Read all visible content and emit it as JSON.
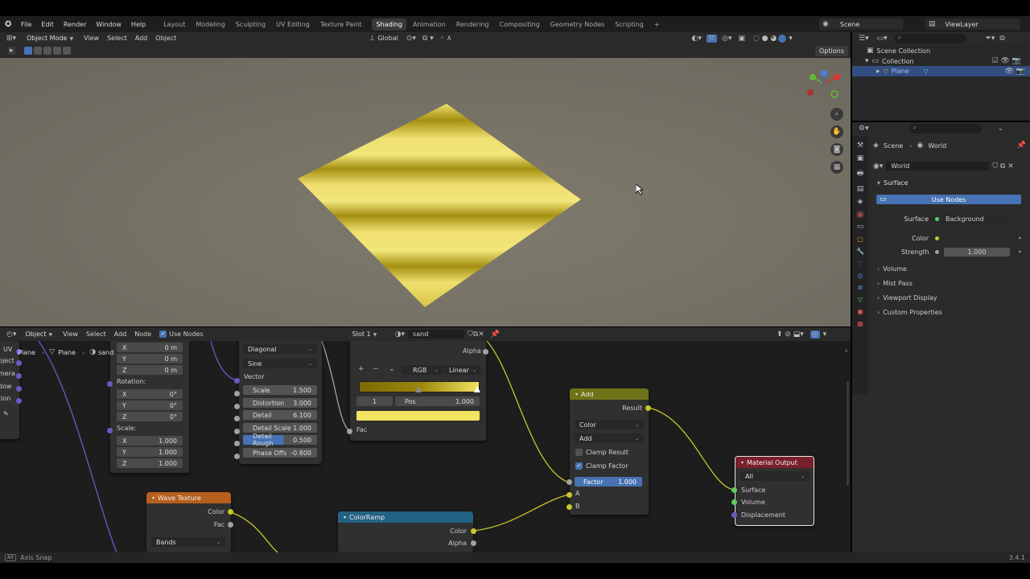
{
  "menubar": {
    "items": [
      "File",
      "Edit",
      "Render",
      "Window",
      "Help"
    ],
    "workspaces": [
      "Layout",
      "Modeling",
      "Sculpting",
      "UV Editing",
      "Texture Paint",
      "Shading",
      "Animation",
      "Rendering",
      "Compositing",
      "Geometry Nodes",
      "Scripting"
    ],
    "active_workspace": "Shading",
    "add_tab": "+",
    "scene": "Scene",
    "view_layer": "ViewLayer"
  },
  "viewport": {
    "mode": "Object Mode",
    "menus": [
      "View",
      "Select",
      "Add",
      "Object"
    ],
    "transform": "Global",
    "options": "Options"
  },
  "outliner": {
    "root": "Scene Collection",
    "collection": "Collection",
    "object": "Plane"
  },
  "properties": {
    "breadcrumb_scene": "Scene",
    "breadcrumb_world": "World",
    "world_name": "World",
    "surface_panel": "Surface",
    "use_nodes": "Use Nodes",
    "surface_label": "Surface",
    "surface_value": "Background",
    "color_label": "Color",
    "strength_label": "Strength",
    "strength_value": "1.000",
    "panels": [
      "Volume",
      "Mist Pass",
      "Viewport Display",
      "Custom Properties"
    ]
  },
  "node_editor": {
    "header": {
      "type": "Object",
      "menus": [
        "View",
        "Select",
        "Add",
        "Node"
      ],
      "use_nodes": "Use Nodes",
      "slot": "Slot 1",
      "material": "sand"
    },
    "breadcrumb": {
      "obj1": "Plane",
      "obj2": "Plane",
      "mat": "sand"
    },
    "left_sockets": [
      "UV",
      "bject",
      "mera",
      "dow",
      "tion"
    ],
    "mapping": {
      "loc": [
        {
          "a": "X",
          "v": "0 m"
        },
        {
          "a": "Y",
          "v": "0 m"
        },
        {
          "a": "Z",
          "v": "0 m"
        }
      ],
      "rotation_label": "Rotation:",
      "rot": [
        {
          "a": "X",
          "v": "0°"
        },
        {
          "a": "Y",
          "v": "0°"
        },
        {
          "a": "Z",
          "v": "0°"
        }
      ],
      "scale_label": "Scale:",
      "scale": [
        {
          "a": "X",
          "v": "1.000"
        },
        {
          "a": "Y",
          "v": "1.000"
        },
        {
          "a": "Z",
          "v": "1.000"
        }
      ]
    },
    "wave_params": {
      "dd1": "Diagonal",
      "dd2": "Sine",
      "vector": "Vector",
      "fields": [
        {
          "l": "Scale",
          "v": "1.500"
        },
        {
          "l": "Distortion",
          "v": "3.000"
        },
        {
          "l": "Detail",
          "v": "6.100"
        },
        {
          "l": "Detail Scale",
          "v": "1.000"
        },
        {
          "l": "Detail Rough",
          "v": "0.500"
        },
        {
          "l": "Phase Offs",
          "v": "-0.800"
        }
      ]
    },
    "ramp_top": {
      "alpha": "Alpha",
      "color_mode": "RGB",
      "interp": "Linear",
      "index": "1",
      "pos_label": "Pos",
      "pos_value": "1.000",
      "fac": "Fac"
    },
    "add_node": {
      "title": "Add",
      "result": "Result",
      "dd1": "Color",
      "dd2": "Add",
      "clamp_result": "Clamp Result",
      "clamp_factor": "Clamp Factor",
      "factor_label": "Factor",
      "factor_value": "1.000",
      "a": "A",
      "b": "B"
    },
    "output_node": {
      "title": "Material Output",
      "target": "All",
      "surface": "Surface",
      "volume": "Volume",
      "displacement": "Displacement"
    },
    "wave_node": {
      "title": "Wave Texture",
      "color": "Color",
      "fac": "Fac",
      "type": "Bands"
    },
    "ramp_node": {
      "title": "ColorRamp",
      "color": "Color",
      "alpha": "Alpha"
    }
  },
  "status": {
    "axis_snap": "Axis Snap",
    "version": "3.4.1"
  },
  "colors": {
    "accent": "#4772b3",
    "texture_header": "#b65f1e",
    "converter_header": "#246283",
    "color_header": "#6e7317",
    "output_header": "#7a1f2c",
    "sand": "#f2e361"
  }
}
